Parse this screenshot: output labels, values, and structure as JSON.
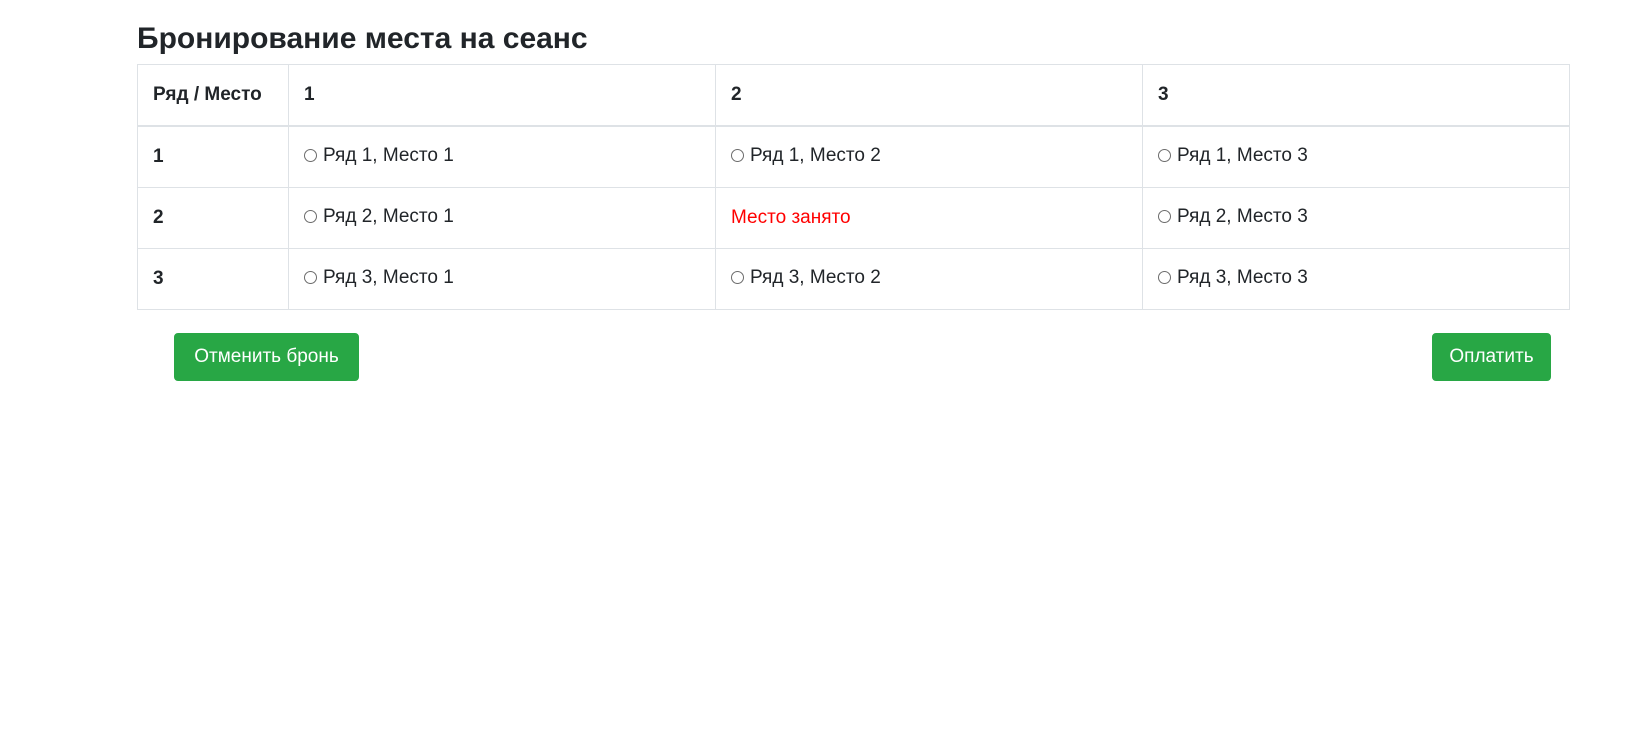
{
  "page": {
    "title": "Бронирование места на сеанс"
  },
  "table": {
    "headers": [
      "Ряд / Место",
      "1",
      "2",
      "3"
    ],
    "rows": [
      {
        "row_label": "1",
        "seats": [
          {
            "label": "Ряд 1, Место 1",
            "taken": false
          },
          {
            "label": "Ряд 1, Место 2",
            "taken": false
          },
          {
            "label": "Ряд 1, Место 3",
            "taken": false
          }
        ]
      },
      {
        "row_label": "2",
        "seats": [
          {
            "label": "Ряд 2, Место 1",
            "taken": false
          },
          {
            "label": "Место занято",
            "taken": true
          },
          {
            "label": "Ряд 2, Место 3",
            "taken": false
          }
        ]
      },
      {
        "row_label": "3",
        "seats": [
          {
            "label": "Ряд 3, Место 1",
            "taken": false
          },
          {
            "label": "Ряд 3, Место 2",
            "taken": false
          },
          {
            "label": "Ряд 3, Место 3",
            "taken": false
          }
        ]
      }
    ]
  },
  "actions": {
    "cancel_label": "Отменить бронь",
    "pay_label": "Оплатить"
  },
  "colors": {
    "button_bg": "#28a745",
    "taken_text": "#ff0000",
    "border": "#dee2e6"
  }
}
